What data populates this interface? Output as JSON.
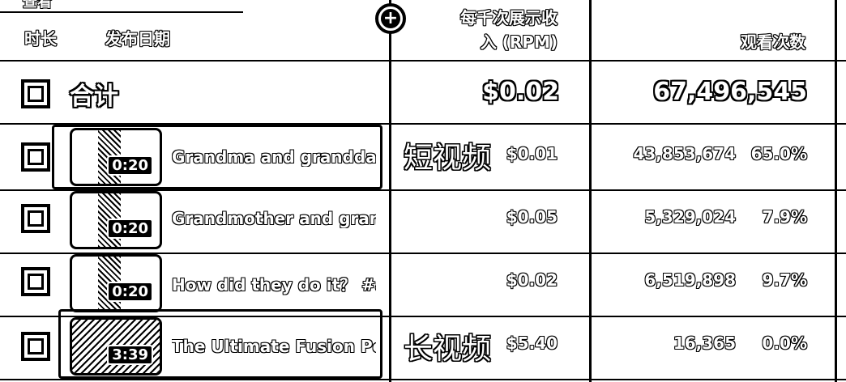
{
  "header": {
    "top_partial": "查看",
    "duration_label": "时长",
    "publish_date_label": "发布日期",
    "rpm_label_line1": "每千次展示收",
    "rpm_label_line2": "入 (RPM)",
    "views_label": "观看次数"
  },
  "total": {
    "label": "合计",
    "rpm": "$0.02",
    "views": "67,496,545"
  },
  "annotations": {
    "shorts": "短视频",
    "long_videos": "长视频"
  },
  "rows": [
    {
      "duration": "0:20",
      "title": "Grandma and granddau...",
      "rpm": "$0.01",
      "views": "43,853,674",
      "percent": "65.0%"
    },
    {
      "duration": "0:20",
      "title": "Grandmother and grand...",
      "rpm": "$0.05",
      "views": "5,329,024",
      "percent": "7.9%"
    },
    {
      "duration": "0:20",
      "title": "How did they do it？ #a...",
      "rpm": "$0.02",
      "views": "6,519,898",
      "percent": "9.7%"
    },
    {
      "duration": "3:39",
      "title": "The Ultimate Fusion Per...",
      "rpm": "$5.40",
      "views": "16,365",
      "percent": "0.0%"
    }
  ],
  "icons": {
    "add": "add-column-icon",
    "checkbox": "checkbox-icon"
  }
}
